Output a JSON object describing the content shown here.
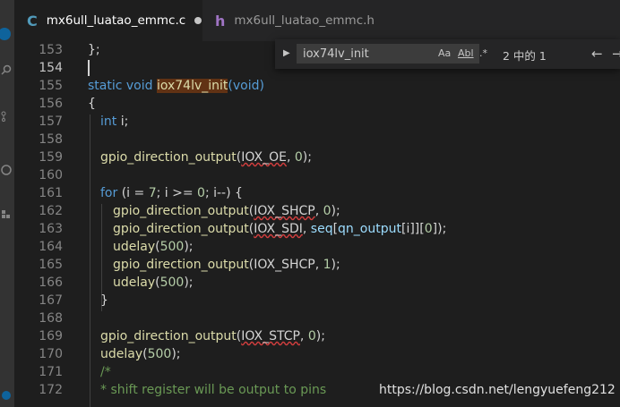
{
  "tabs": [
    {
      "icon": "C",
      "label": "mx6ull_luatao_emmc.c",
      "dirty": true,
      "active": true
    },
    {
      "icon": "h",
      "label": "mx6ull_luatao_emmc.h",
      "dirty": false,
      "active": false
    }
  ],
  "find": {
    "query": "iox74lv_init",
    "match_case": "Aa",
    "whole_word": "Abl",
    "regex": ".*",
    "result": "2 中的 1",
    "prev_icon": "←",
    "next_icon": "→",
    "toggle_icon": "▶"
  },
  "line_numbers": [
    "153",
    "154",
    "155",
    "156",
    "157",
    "158",
    "159",
    "160",
    "161",
    "162",
    "163",
    "164",
    "165",
    "166",
    "167",
    "168",
    "169",
    "170",
    "171",
    "172"
  ],
  "current_line": "154",
  "code": {
    "l153": "};",
    "l155_kw": "static void ",
    "l155_name": "iox74lv_init",
    "l155_args": "(void)",
    "l156": "{",
    "l157_type": "int ",
    "l157_rest": "i;",
    "l159_fn": "gpio_direction_output",
    "l159_open": "(",
    "l159_arg": "IOX_OE",
    "l159_sep": ", ",
    "l159_num": "0",
    "l159_end": ");",
    "l161_kw": "for",
    "l161_p1": " (i = ",
    "l161_n1": "7",
    "l161_p2": "; i >= ",
    "l161_n2": "0",
    "l161_p3": "; i--) {",
    "l162_fn": "gpio_direction_output",
    "l162_open": "(",
    "l162_arg": "IOX_SHCP",
    "l162_sep": ", ",
    "l162_num": "0",
    "l162_end": ");",
    "l163_fn": "gpio_direction_output",
    "l163_open": "(",
    "l163_arg": "IOX_SDI",
    "l163_sep": ", ",
    "l163_seq": "seq",
    "l163_b1": "[",
    "l163_qn": "qn_output",
    "l163_b2": "[i]][",
    "l163_num": "0",
    "l163_end": "]);",
    "l164_fn": "udelay",
    "l164_open": "(",
    "l164_num": "500",
    "l164_end": ");",
    "l165_fn": "gpio_direction_output",
    "l165_open": "(",
    "l165_arg": "IOX_SHCP",
    "l165_sep": ", ",
    "l165_num": "1",
    "l165_end": ");",
    "l166_fn": "udelay",
    "l166_open": "(",
    "l166_num": "500",
    "l166_end": ");",
    "l167": "}",
    "l169_fn": "gpio_direction_output",
    "l169_open": "(",
    "l169_arg": "IOX_STCP",
    "l169_sep": ", ",
    "l169_num": "0",
    "l169_end": ");",
    "l170_fn": "udelay",
    "l170_open": "(",
    "l170_num": "500",
    "l170_end": ");",
    "l171": "/*",
    "l172": "* shift register will be output to pins"
  },
  "watermark": "https://blog.csdn.net/lengyuefeng212",
  "colors": {
    "keyword": "#569cd6",
    "function": "#dcdcaa",
    "number": "#b5cea8",
    "variable": "#9cdcfe",
    "comment": "#6a9955",
    "find_highlight": "#613214"
  }
}
